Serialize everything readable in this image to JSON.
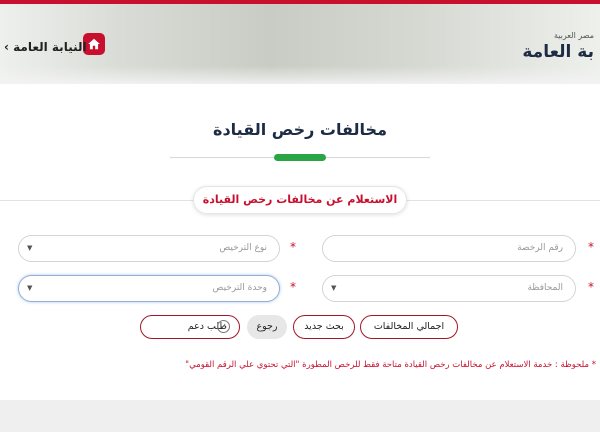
{
  "header": {
    "nav_label": "النيابة العامة ›",
    "brand_subtitle": "مصر العربية",
    "brand_title": "بة العامة",
    "home_icon": "home-icon",
    "accent_color": "#c8102e"
  },
  "page": {
    "title": "مخالفات رخص القيادة",
    "section_label": "الاستعلام عن مخالفات رخص القيادة"
  },
  "form": {
    "license_number_placeholder": "رقم الرخصة",
    "license_type_placeholder": "نوع الترخيص",
    "governorate_placeholder": "المحافظة",
    "license_unit_placeholder": "وحدة الترخيص",
    "required_mark": "*"
  },
  "buttons": {
    "total_violations": "اجمالي المخالفات",
    "new_search": "بحث جديد",
    "back": "رجوع",
    "support_request": "طلب دعم"
  },
  "note": "* ملحوظة : خدمة الاستعلام عن مخالفات رخص القيادة متاحة فقط للرخص المطورة \"التي تحتوي علي الرقم القومي\""
}
